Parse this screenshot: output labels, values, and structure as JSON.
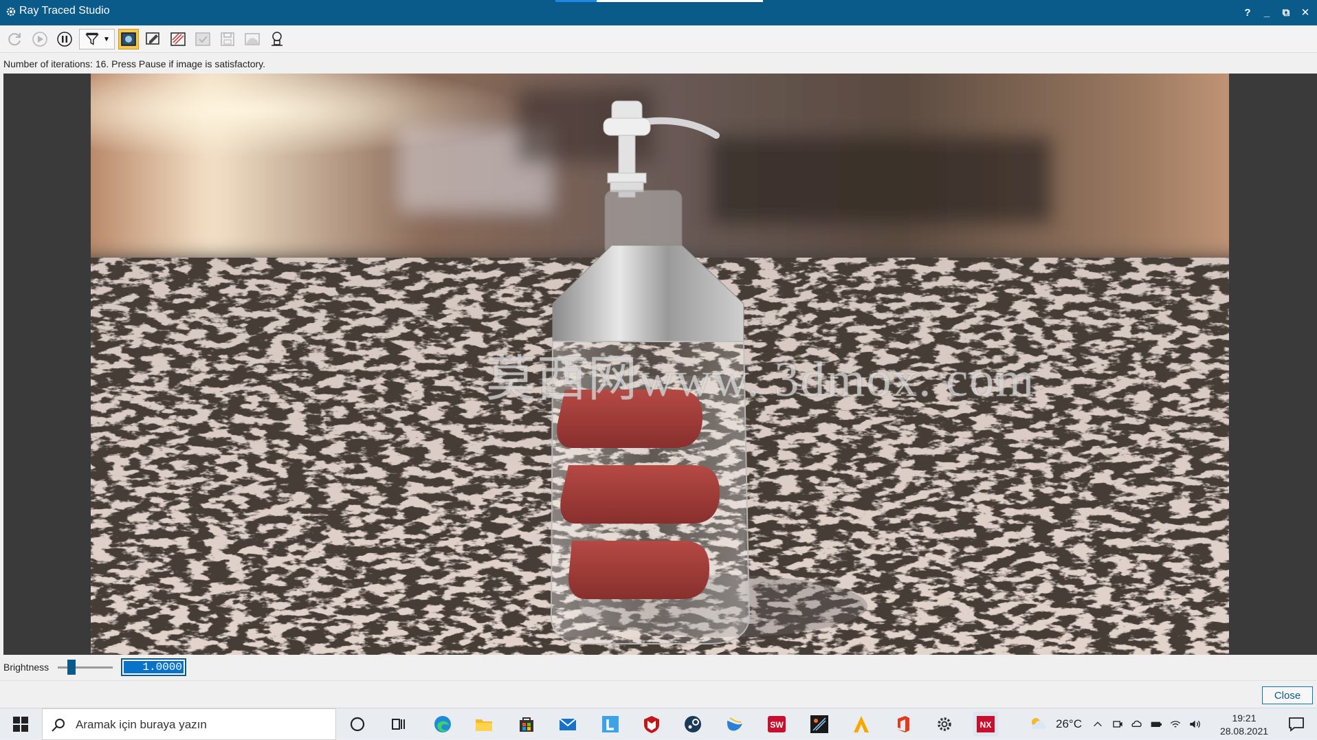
{
  "window": {
    "title": "Ray Traced Studio",
    "controls": [
      "?",
      "_",
      "⧉",
      "✕"
    ]
  },
  "toolbar": {
    "buttons": [
      {
        "name": "refresh-icon",
        "enabled": false
      },
      {
        "name": "play-icon",
        "enabled": false
      },
      {
        "name": "pause-icon",
        "enabled": true
      },
      {
        "name": "filter-icon",
        "enabled": true
      },
      {
        "name": "image-window-icon",
        "enabled": true
      },
      {
        "name": "edit-scene-icon",
        "enabled": true
      },
      {
        "name": "shading-icon",
        "enabled": true
      },
      {
        "name": "apply-icon",
        "enabled": false
      },
      {
        "name": "save-image-icon",
        "enabled": false
      },
      {
        "name": "background-icon",
        "enabled": false
      },
      {
        "name": "lighting-icon",
        "enabled": true
      }
    ]
  },
  "status": {
    "text": "Number of iterations: 16.  Press Pause if image is satisfactory."
  },
  "render": {
    "watermark": "莫西网www. 3dmox. com"
  },
  "brightness": {
    "label": "Brightness",
    "value": "1.0000",
    "slider_fraction": 0.2
  },
  "dialog": {
    "close_label": "Close"
  },
  "taskbar": {
    "search_placeholder": "Aramak için buraya yazın",
    "apps": [
      "cortana-icon",
      "task-view-icon",
      "edge-icon",
      "file-explorer-icon",
      "store-icon",
      "mail-icon",
      "l-app-icon",
      "mcafee-icon",
      "steam-icon",
      "teams-bird-icon",
      "solidworks-icon",
      "ds-app-icon",
      "altium-icon",
      "office-icon",
      "settings-icon",
      "nx-icon"
    ],
    "solidworks_badge": "SW",
    "nx_badge": "NX",
    "weather": "26°C",
    "time": "19:21",
    "date": "28.08.2021"
  },
  "colors": {
    "title_bar": "#0a5a8a",
    "accent": "#0a73c8"
  }
}
